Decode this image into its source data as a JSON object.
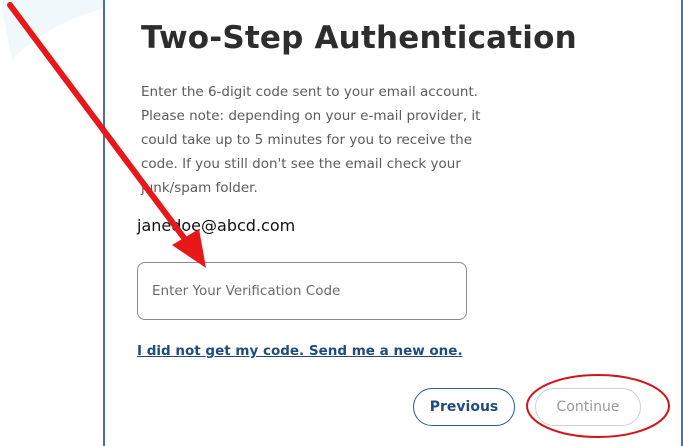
{
  "dialog": {
    "title": "Two-Step Authentication",
    "instructions": "Enter the 6-digit code sent to your email account. Please note: depending on your e-mail provider, it could take up to 5 minutes for you to receive the code. If you still don't see the email check your junk/spam folder.",
    "email": "janedoe@abcd.com",
    "code_input": {
      "placeholder": "Enter Your Verification Code",
      "value": ""
    },
    "resend_link": "I did not get my code. Send me a new one.",
    "buttons": {
      "previous": "Previous",
      "continue": "Continue"
    }
  },
  "annotations": {
    "arrow_color": "#e8171a",
    "circle_color": "#d4141b"
  },
  "colors": {
    "card_border": "#4a6fa5",
    "link": "#1f4c7d",
    "title": "#2d2d2d",
    "body_text": "#5b5b5b",
    "disabled_text": "#9a9a9a"
  }
}
